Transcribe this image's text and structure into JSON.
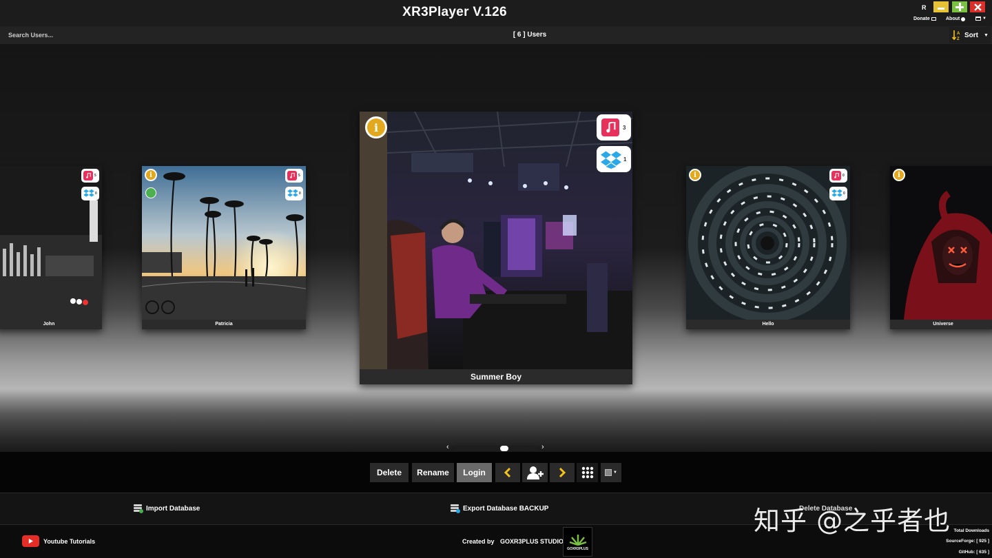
{
  "app": {
    "title": "XR3Player V.126",
    "window": {
      "r_label": "R",
      "donate_label": "Donate",
      "about_label": "About"
    }
  },
  "search": {
    "placeholder": "Search Users...",
    "count_label": "[ 6 ] Users",
    "sort_label": "Sort"
  },
  "users": [
    {
      "name": "John",
      "playlists": "5",
      "dropbox": "0"
    },
    {
      "name": "Patricia",
      "playlists": "5",
      "dropbox": "0"
    },
    {
      "name": "Summer Boy",
      "playlists": "3",
      "dropbox": "1"
    },
    {
      "name": "Hello",
      "playlists": "0",
      "dropbox": "0"
    },
    {
      "name": "Universe"
    }
  ],
  "controls": {
    "delete_label": "Delete",
    "rename_label": "Rename",
    "login_label": "Login",
    "icons": [
      "chevron-left-icon",
      "add-user-icon",
      "chevron-right-icon",
      "grid-icon",
      "view-mode-icon"
    ]
  },
  "database": {
    "import_label": "Import Database",
    "export_label": "Export Database BACKUP",
    "delete_label": "Delete Database"
  },
  "footer": {
    "youtube_label": "Youtube Tutorials",
    "created_by_label": "Created by",
    "studio_label": "GOXR3PLUS STUDIO",
    "logo_text": "GOXR3PLUS",
    "total_downloads_label": "Total Downloads",
    "sourceforge_label": "SourceForge: [ 925 ]",
    "github_label": "GitHub: [ 635 ]"
  },
  "watermark": "知乎 @之乎者也",
  "colors": {
    "info": "#e2a81e",
    "music": "#e8305c",
    "dropbox": "#2aa8e8",
    "minimize": "#e8c235",
    "maximize": "#7ac143",
    "close": "#d9302b",
    "accent_yellow": "#f4c21c"
  }
}
